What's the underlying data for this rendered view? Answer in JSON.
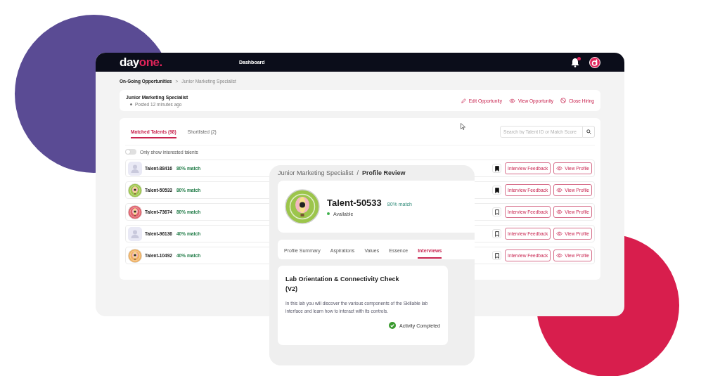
{
  "header": {
    "logo": {
      "part_1": "day",
      "part_2": "one."
    },
    "nav": [
      {
        "label": "Dashboard",
        "selected": true
      }
    ],
    "notification": {
      "unread": true
    }
  },
  "breadcrumb": {
    "parent": "On-Going Opportunities",
    "separator": ">",
    "current": "Junior Marketing Specialist"
  },
  "opportunity": {
    "title": "Junior Marketing Specialist",
    "posted": "Posted 12 minutes ago",
    "actions": [
      {
        "kind": "edit",
        "label": "Edit Opportunity"
      },
      {
        "kind": "view",
        "label": "View Opportunity"
      },
      {
        "kind": "close",
        "label": "Close Hiring"
      }
    ]
  },
  "tabs": [
    {
      "label": "Matched Talents (98)",
      "selected": true
    },
    {
      "label": "Shortlisted (2)",
      "selected": false
    }
  ],
  "search": {
    "placeholder": "Search by Talent ID or Match Score"
  },
  "filter": {
    "label": "Only show interested talents",
    "on": false
  },
  "talents": [
    {
      "name": "Talent-88416",
      "match": "80% match",
      "avatar": {
        "kind": "placeholder"
      },
      "bookmarked": true,
      "feedback_button": "Interview Feedback",
      "profile_button": "View Profile"
    },
    {
      "name": "Talent-50533",
      "match": "80% match",
      "avatar": {
        "kind": "badge",
        "color": "#9cc54b"
      },
      "bookmarked": true,
      "feedback_button": "Interview Feedback",
      "profile_button": "View Profile"
    },
    {
      "name": "Talent-73674",
      "match": "80% match",
      "avatar": {
        "kind": "badge",
        "color": "#e0606a"
      },
      "bookmarked": false,
      "feedback_button": "Interview Feedback",
      "profile_button": "View Profile"
    },
    {
      "name": "Talent-96136",
      "match": "40% match",
      "avatar": {
        "kind": "placeholder"
      },
      "bookmarked": false,
      "feedback_button": "Interview Feedback",
      "profile_button": "View Profile"
    },
    {
      "name": "Talent-10492",
      "match": "40% match",
      "avatar": {
        "kind": "badge",
        "color": "#f0b060"
      },
      "bookmarked": false,
      "feedback_button": "Interview Feedback",
      "profile_button": "View Profile"
    }
  ],
  "profile_review": {
    "breadcrumb": {
      "parent": "Junior Marketing Specialist",
      "separator": "/",
      "current": "Profile Review"
    },
    "talent": {
      "name": "Talent-50533",
      "match": "80% match",
      "status": "Available",
      "avatar": {
        "kind": "badge",
        "color": "#9cc54b"
      }
    },
    "tabs": [
      {
        "label": "Profile Summary",
        "selected": false
      },
      {
        "label": "Aspirations",
        "selected": false
      },
      {
        "label": "Values",
        "selected": false
      },
      {
        "label": "Essence",
        "selected": false
      },
      {
        "label": "Interviews",
        "selected": true
      }
    ],
    "interview": {
      "title": "Lab Orientation & Connectivity Check (V2)",
      "description": "In this lab you will discover the various components of the Skillable lab interface and learn how to interact with its controls.",
      "status": "Activity Completed",
      "completed": true
    }
  }
}
